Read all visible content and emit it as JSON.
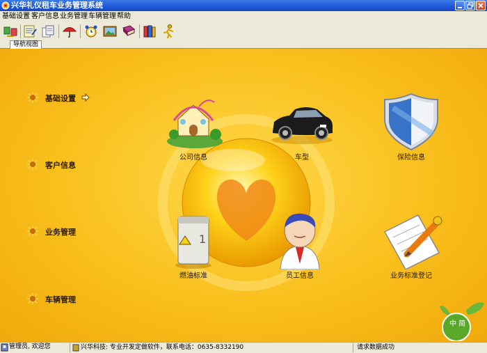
{
  "window": {
    "title": "兴华礼仪租车业务管理系统"
  },
  "menu": [
    "基础设置",
    "客户信息",
    "业务管理",
    "车辆管理",
    "帮助"
  ],
  "toolbar_icons": [
    "transfer-icon",
    "notes-icon",
    "documents-icon",
    "umbrella-icon",
    "alarm-clock-icon",
    "picture-icon",
    "book-icon",
    "files-icon",
    "running-man-icon"
  ],
  "tab": {
    "label": "导航视图"
  },
  "nav": [
    {
      "label": "基础设置",
      "arrow": true
    },
    {
      "label": "客户信息"
    },
    {
      "label": "业务管理"
    },
    {
      "label": "车辆管理"
    }
  ],
  "features": [
    {
      "label": "公司信息",
      "icon": "house-icon"
    },
    {
      "label": "车型",
      "icon": "car-icon"
    },
    {
      "label": "保险信息",
      "icon": "shield-icon"
    },
    {
      "label": "燃油标准",
      "icon": "fuel-cabinet-icon"
    },
    {
      "label": "员工信息",
      "icon": "employee-icon"
    },
    {
      "label": "业务标准登记",
      "icon": "document-pen-icon"
    }
  ],
  "badge": {
    "text": "中 简",
    "icon": "leaf-badge-icon"
  },
  "status": {
    "user": "管理员, 欢迎您",
    "company": "兴华科技: 专业开发定做软件，联系电话：0635-8332190",
    "message": "请求数据成功"
  },
  "colors": {
    "title_bar": "#1c57d6",
    "background": "#f9bf1c",
    "chrome": "#ece9d8"
  }
}
